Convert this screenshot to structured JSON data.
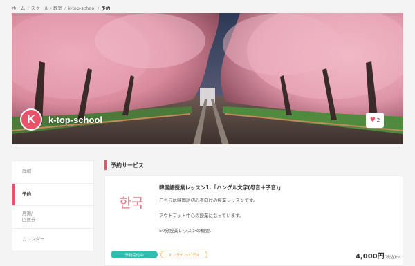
{
  "breadcrumb": {
    "items": [
      "ホーム",
      "スクール・教室",
      "k-top-school",
      "予約"
    ]
  },
  "header": {
    "school_name": "k-top-school",
    "avatar_letter": "K",
    "like_count": "2"
  },
  "sidebar": {
    "items": [
      {
        "label": "詳細",
        "active": false
      },
      {
        "label": "予約",
        "active": true
      },
      {
        "label": "月謝/\n回数券",
        "active": false
      },
      {
        "label": "カレンダー",
        "active": false
      }
    ]
  },
  "main": {
    "section_title": "予約サービス",
    "service": {
      "thumbnail_text": "한국",
      "title": "韓国語授業レッスン1.「ハングル文字(母音＋子音)」",
      "description": [
        "こちらは韓国語初心者向けの授業レッスンです。",
        "アウトプット中心の授業になっています。",
        "50分授業レッスンの概要.."
      ],
      "badge_status": "予約受付中",
      "badge_online": "オンライン/ビデオ",
      "price": "4,000円",
      "price_suffix": "(税込)〜"
    }
  },
  "colors": {
    "accent": "#e8536a",
    "teal": "#2fbfae",
    "background": "#f4f4f4"
  }
}
